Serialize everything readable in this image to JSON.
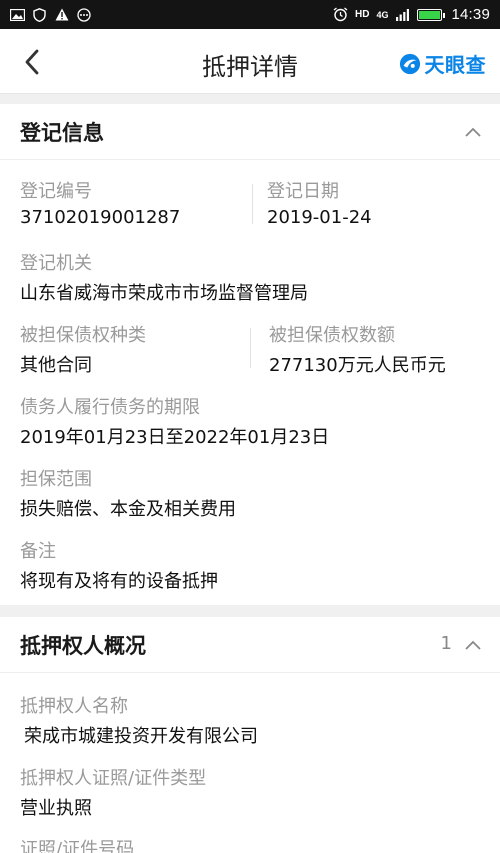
{
  "status_bar": {
    "time": "14:39",
    "network": "4G",
    "hd": "HD",
    "left_icons": [
      "image-icon",
      "shield-icon",
      "warning-icon",
      "more-icon"
    ],
    "battery_level": 0.9,
    "battery_color": "#39d34a"
  },
  "header": {
    "title": "抵押详情",
    "brand_name": "天眼查",
    "brand_color": "#0a84e6"
  },
  "registration": {
    "title": "登记信息",
    "fields": {
      "reg_no_label": "登记编号",
      "reg_no": "37102019001287",
      "reg_date_label": "登记日期",
      "reg_date": "2019-01-24",
      "authority_label": "登记机关",
      "authority": "山东省威海市荣成市市场监督管理局",
      "claim_type_label": "被担保债权种类",
      "claim_type": "其他合同",
      "claim_amount_label": "被担保债权数额",
      "claim_amount": "277130万元人民币元",
      "term_label": "债务人履行债务的期限",
      "term": "2019年01月23日至2022年01月23日",
      "scope_label": "担保范围",
      "scope": "损失赔偿、本金及相关费用",
      "remark_label": "备注",
      "remark": "将现有及将有的设备抵押"
    }
  },
  "mortgagee": {
    "title": "抵押权人概况",
    "count": "1",
    "fields": {
      "name_label": "抵押权人名称",
      "name": "荣成市城建投资开发有限公司",
      "cert_type_label": "抵押权人证照/证件类型",
      "cert_type": "营业执照",
      "cert_no_label": "证照/证件号码"
    }
  }
}
